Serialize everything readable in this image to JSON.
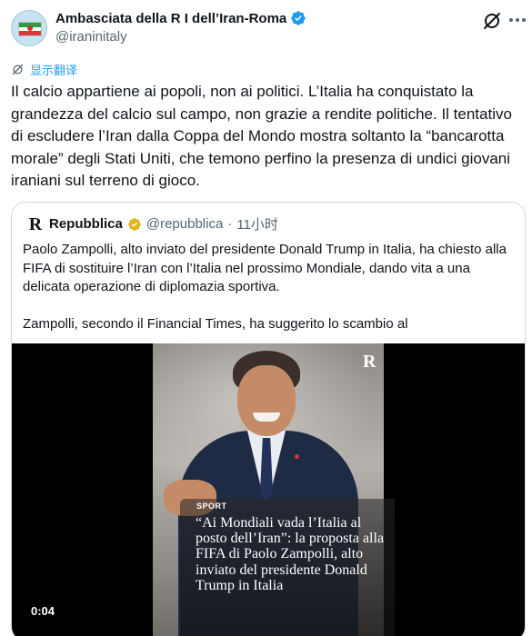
{
  "author": {
    "display_name": "Ambasciata della R I dell’Iran-Roma",
    "handle": "@iraninitaly"
  },
  "translate": {
    "label": "显示翻译"
  },
  "post": {
    "text": "Il calcio appartiene ai popoli, non ai politici. L’Italia ha conquistato la grandezza del calcio sul campo, non grazie a rendite politiche. Il tentativo di escludere l’Iran dalla Coppa del Mondo mostra soltanto la “bancarotta morale” degli Stati Uniti, che temono perfino la presenza di undici giovani iraniani sul terreno di gioco."
  },
  "quote": {
    "logo_letter": "R",
    "name": "Repubblica",
    "handle": "@repubblica",
    "separator": "·",
    "time": "11小时",
    "text": "Paolo Zampolli, alto inviato del presidente Donald Trump in Italia, ha chiesto alla FIFA di sostituire l’Iran con l’Italia nel prossimo Mondiale, dando vita a una delicata operazione di diplomazia sportiva.\n\nZampolli, secondo il Financial Times, ha suggerito lo scambio al",
    "video": {
      "watermark": "R",
      "tag": "SPORT",
      "headline": "“Ai Mondiali vada l’Italia al posto dell’Iran”: la proposta alla FIFA di Paolo Zampolli, alto inviato del presidente Donald Trump in Italia",
      "timestamp": "0:04"
    }
  },
  "icons": {
    "verified": "verified-badge-icon",
    "grok": "grok-icon",
    "more": "more-options-icon",
    "translate": "translate-icon",
    "gold_check": "gold-verified-icon"
  },
  "colors": {
    "accent": "#1d9bf0",
    "gold": "#e2b719",
    "text": "#0f1419",
    "muted": "#536471",
    "border": "#cfd9de"
  }
}
